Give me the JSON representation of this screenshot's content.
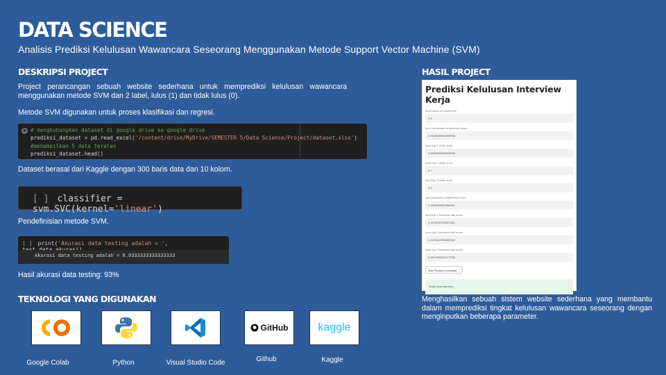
{
  "header": {
    "title": "DATA SCIENCE",
    "subtitle": "Analisis Prediksi Kelulusan Wawancara Seseorang Menggunakan Metode Support Vector Machine (SVM)"
  },
  "description": {
    "heading": "DESKRIPSI PROJECT",
    "para1": "Project perancangan sebuah website sederhana untuk memprediksi kelulusan wawancara menggunakan metode SVM dan 2 label, lulus (1) dan tidak lulus (0).",
    "para2": "Metode SVM digunakan untuk proses klasifikasi dan regresi.",
    "code1": {
      "line1": "# menghubungkan dataset di google drive ke google drive",
      "line2_a": "prediksi_dataset = pd.read_excel(",
      "line2_str": "'/content/drive/MyDrive/SEMESTER 5/Data Science/Project/dataset.xlsx'",
      "line2_b": ")",
      "line3": "#menampilkan 5 data teratas",
      "line4": "prediksi_dataset.head()"
    },
    "caption1": "Dataset berasal dari Kaggle dengan 300 baris data dan 10 kolom.",
    "code2": {
      "bracket": "[ ]",
      "code_a": "classifier = svm.SVC(kernel=",
      "code_str": "'linear'",
      "code_b": ")"
    },
    "caption2": "Pendefinisian metode SVM.",
    "code3": {
      "bracket": "[ ]",
      "code_a": "print(",
      "code_str": "'Akurasi data testing adalah = '",
      "code_b": ", test_data_akurasi)",
      "output": "Akurasi data testing adalah =  0.9333333333333333"
    },
    "caption3": "Hasil akurasi data testing: 93%"
  },
  "tech": {
    "heading": "TEKNOLOGI YANG DIGUNAKAN",
    "items": [
      {
        "label": "Google Colab",
        "icon": "google-colab-logo"
      },
      {
        "label": "Python",
        "icon": "python-logo"
      },
      {
        "label": "Visual Studio Code",
        "icon": "vscode-logo"
      },
      {
        "label": "Github",
        "icon": "github-logo",
        "logo_text": "GitHub"
      },
      {
        "label": "Kaggle",
        "icon": "kaggle-logo",
        "logo_text": "kaggle"
      }
    ]
  },
  "result": {
    "heading": "HASIL PROJECT",
    "panel_title": "Prediksi Kelulusan Interview Kerja",
    "fields": [
      {
        "label": "Input years of experience",
        "value": "0.4"
      },
      {
        "label": "Input functional competency score",
        "value": "0.6625599999999998"
      },
      {
        "label": "Input top 1 skills score",
        "value": "0.6666666666666666"
      },
      {
        "label": "Input top 2 skills score",
        "value": "0.7"
      },
      {
        "label": "Input top 3 skills score",
        "value": "0.5"
      },
      {
        "label": "Input behavior competency score",
        "value": "0.4653284632584541"
      },
      {
        "label": "Input top 1 behavior skill score",
        "value": "0.4978287376972361"
      },
      {
        "label": "Input top 2 behavior skill score",
        "value": "0.3573442253681384"
      },
      {
        "label": "Input top 3 behavior skill score",
        "value": "0.3917595252277358"
      }
    ],
    "button_label": "Test Prediksi Kelulusan",
    "result_text": "Anda lulus interview",
    "description": "Menghasilkan sebuah sistem website sederhana yang membantu dalam memprediksi tingkat kelulusan wawancara seseorang dengan menginputkan beberapa parameter."
  },
  "colors": {
    "background": "#2e5c9a",
    "code_bg": "#1f1f1f",
    "comment": "#6a9955",
    "string": "#ce9178"
  }
}
